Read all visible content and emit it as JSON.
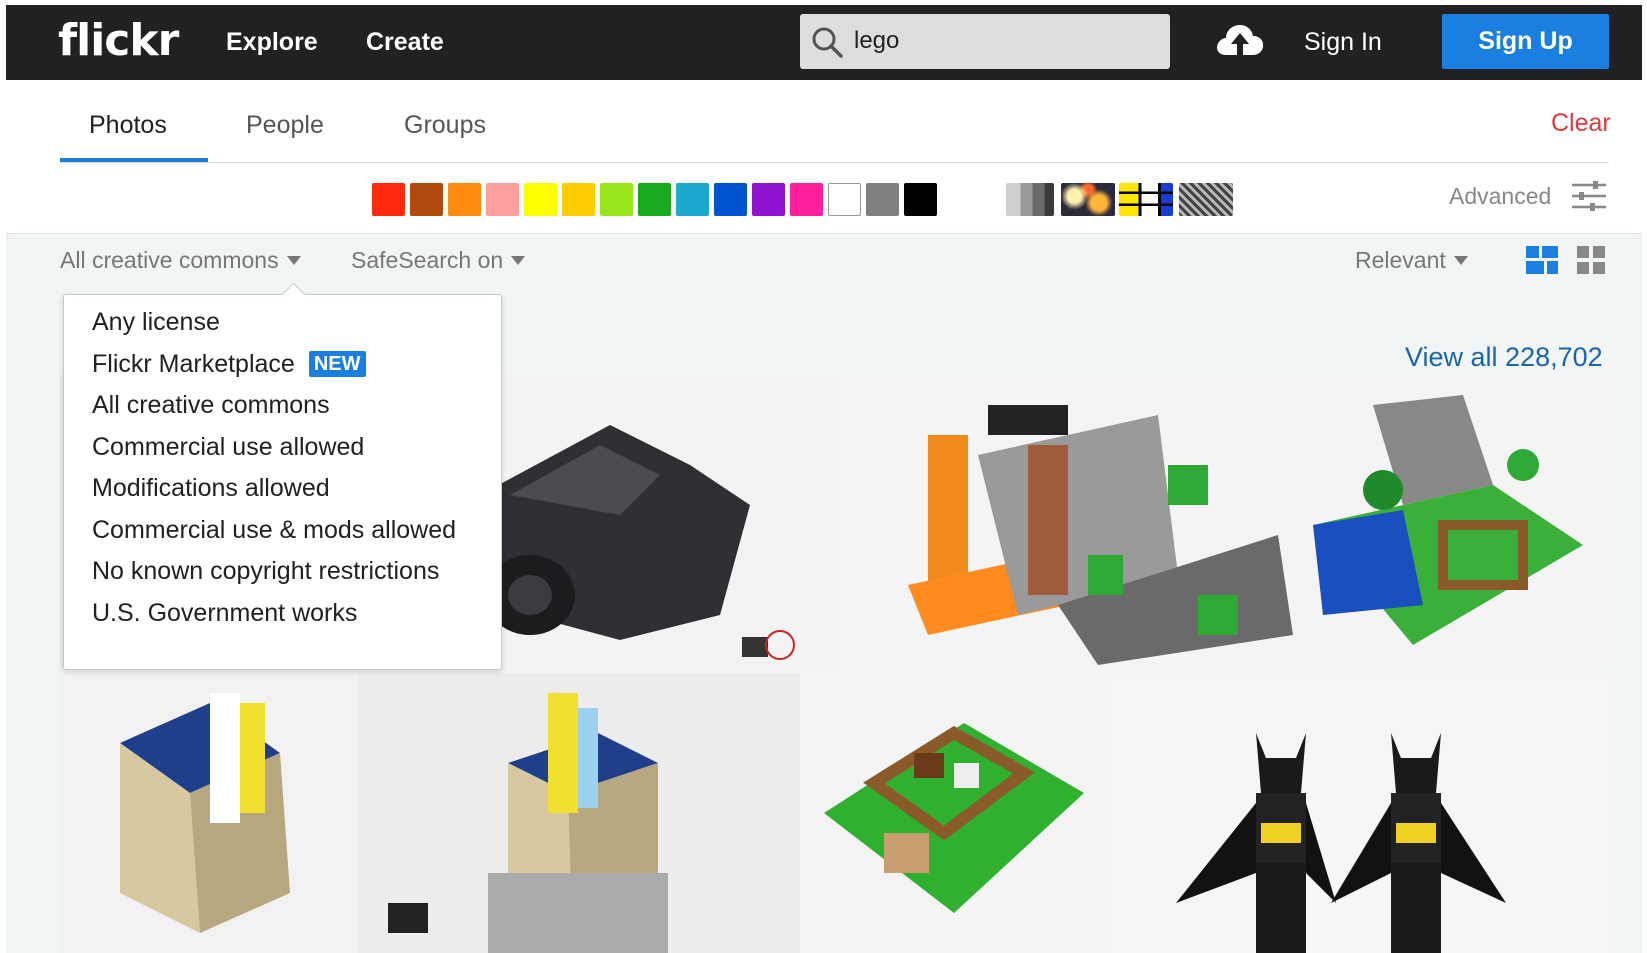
{
  "header": {
    "logo": "flickr",
    "nav": [
      "Explore",
      "Create"
    ],
    "search_value": "lego",
    "sign_in": "Sign In",
    "sign_up": "Sign Up"
  },
  "tabs": {
    "items": [
      "Photos",
      "People",
      "Groups"
    ],
    "active": "Photos",
    "clear": "Clear"
  },
  "color_filter": {
    "swatches": [
      "#ff2a0d",
      "#b04a0d",
      "#ff8a0f",
      "#ff9e9e",
      "#ffff00",
      "#ffcc00",
      "#99e51c",
      "#19a91c",
      "#1ca9cf",
      "#0054cf",
      "#8f13cf",
      "#ff1f9a",
      "#ffffff",
      "#808080",
      "#000000"
    ],
    "pattern_icons": [
      "tone-icon",
      "depth-of-field-icon",
      "minimalist-icon",
      "pattern-icon"
    ],
    "advanced": "Advanced"
  },
  "filters": {
    "license": "All creative commons",
    "safesearch": "SafeSearch on",
    "sort": "Relevant",
    "views": [
      "justified-view-icon",
      "grid-view-icon"
    ]
  },
  "results": {
    "view_all": "View all 228,702"
  },
  "license_dropdown": {
    "options": [
      "Any license",
      "Flickr Marketplace",
      "All creative commons",
      "Commercial use allowed",
      "Modifications allowed",
      "Commercial use & mods allowed",
      "No known copyright restrictions",
      "U.S. Government works"
    ],
    "new_badge": "NEW"
  },
  "photos": [
    "lego-photo-1",
    "lego-batmobile",
    "lego-minecraft-cave",
    "lego-minecraft-village",
    "lego-building-1",
    "lego-theater",
    "lego-minecraft-farm",
    "lego-batman-minifigs"
  ]
}
